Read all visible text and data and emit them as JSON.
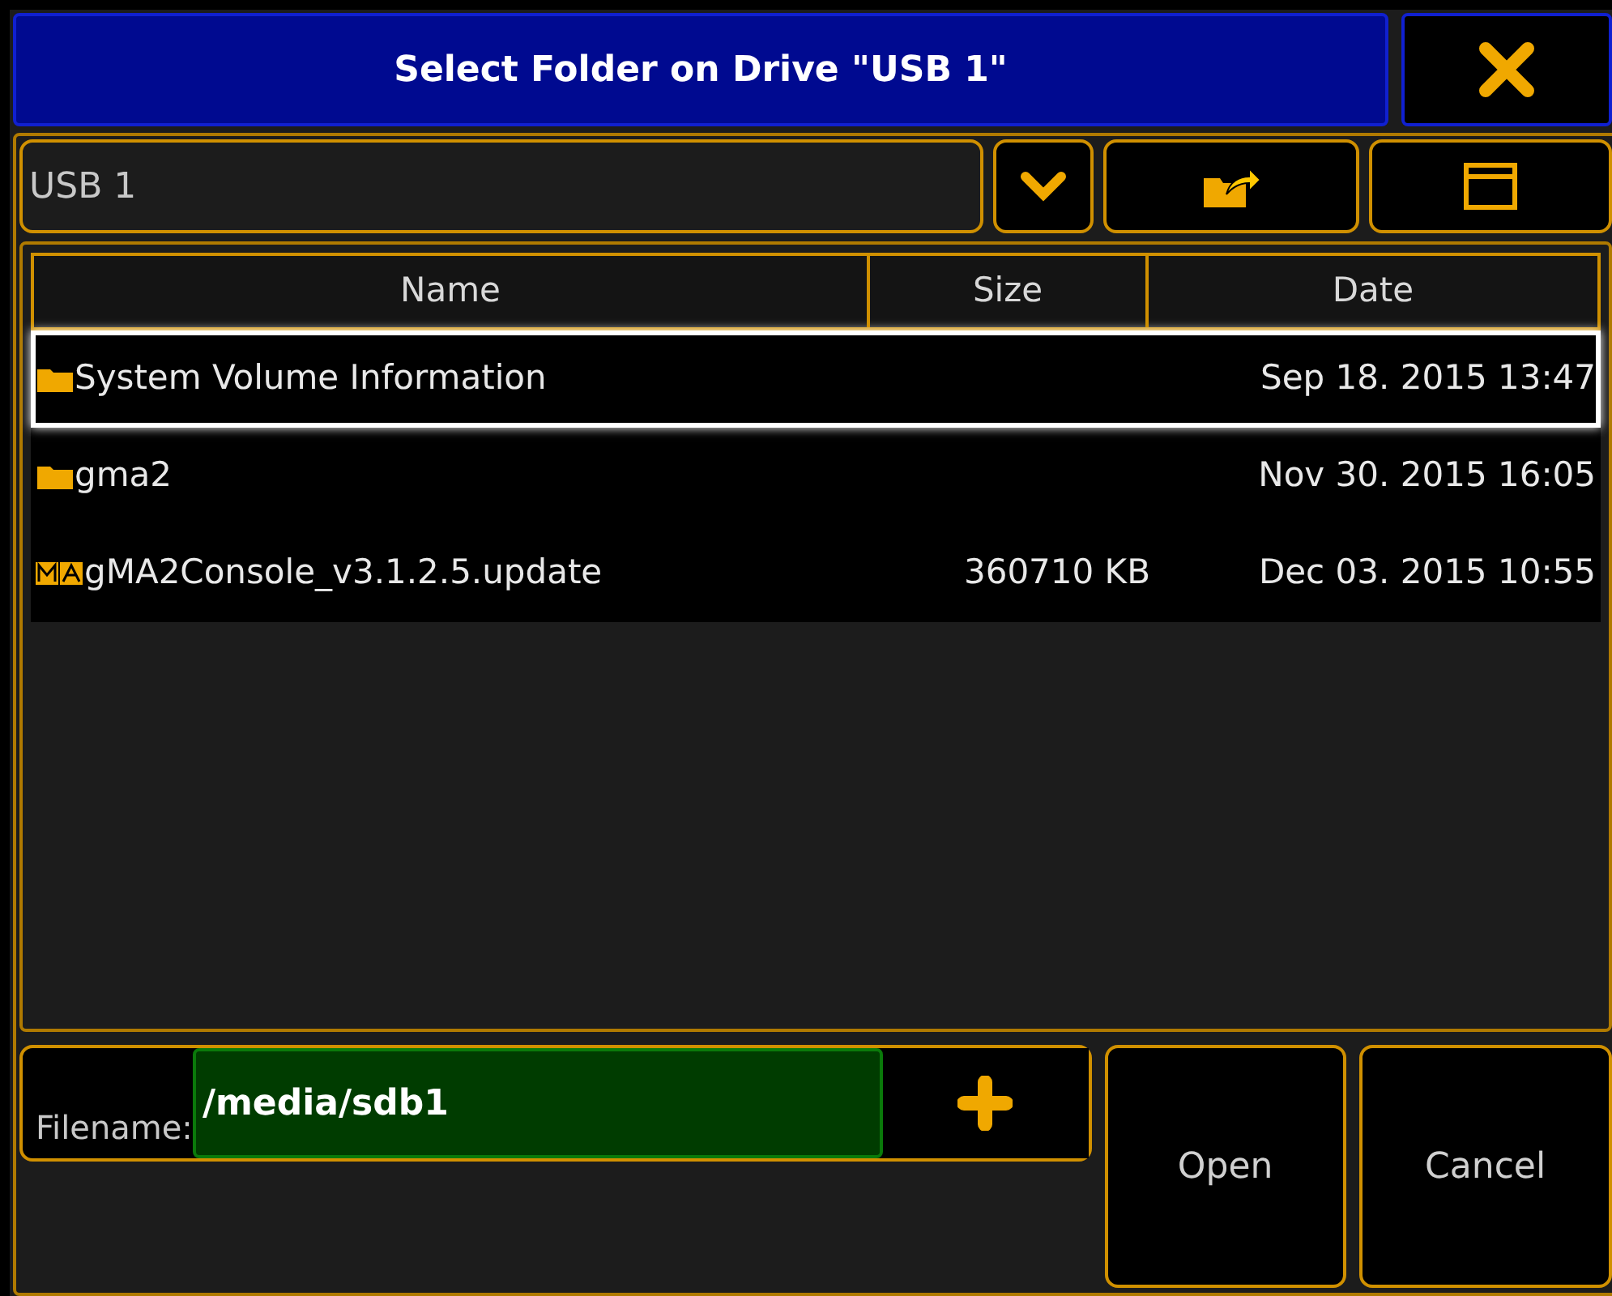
{
  "window": {
    "title": "Select Folder on Drive \"USB 1\""
  },
  "drive": {
    "value": "USB 1"
  },
  "table": {
    "columns": [
      "Name",
      "Size",
      "Date"
    ],
    "rows": [
      {
        "kind": "folder",
        "name": "System Volume Information",
        "size": "",
        "date": "Sep 18. 2015 13:47",
        "selected": true
      },
      {
        "kind": "folder",
        "name": "gma2",
        "size": "",
        "date": "Nov 30. 2015 16:05",
        "selected": false
      },
      {
        "kind": "file",
        "name": "gMA2Console_v3.1.2.5.update",
        "size": "360710 KB",
        "date": "Dec 03. 2015 10:55",
        "selected": false
      }
    ]
  },
  "filename": {
    "label": "Filename:",
    "value": "/media/sdb1"
  },
  "buttons": [
    "Open",
    "Cancel"
  ]
}
